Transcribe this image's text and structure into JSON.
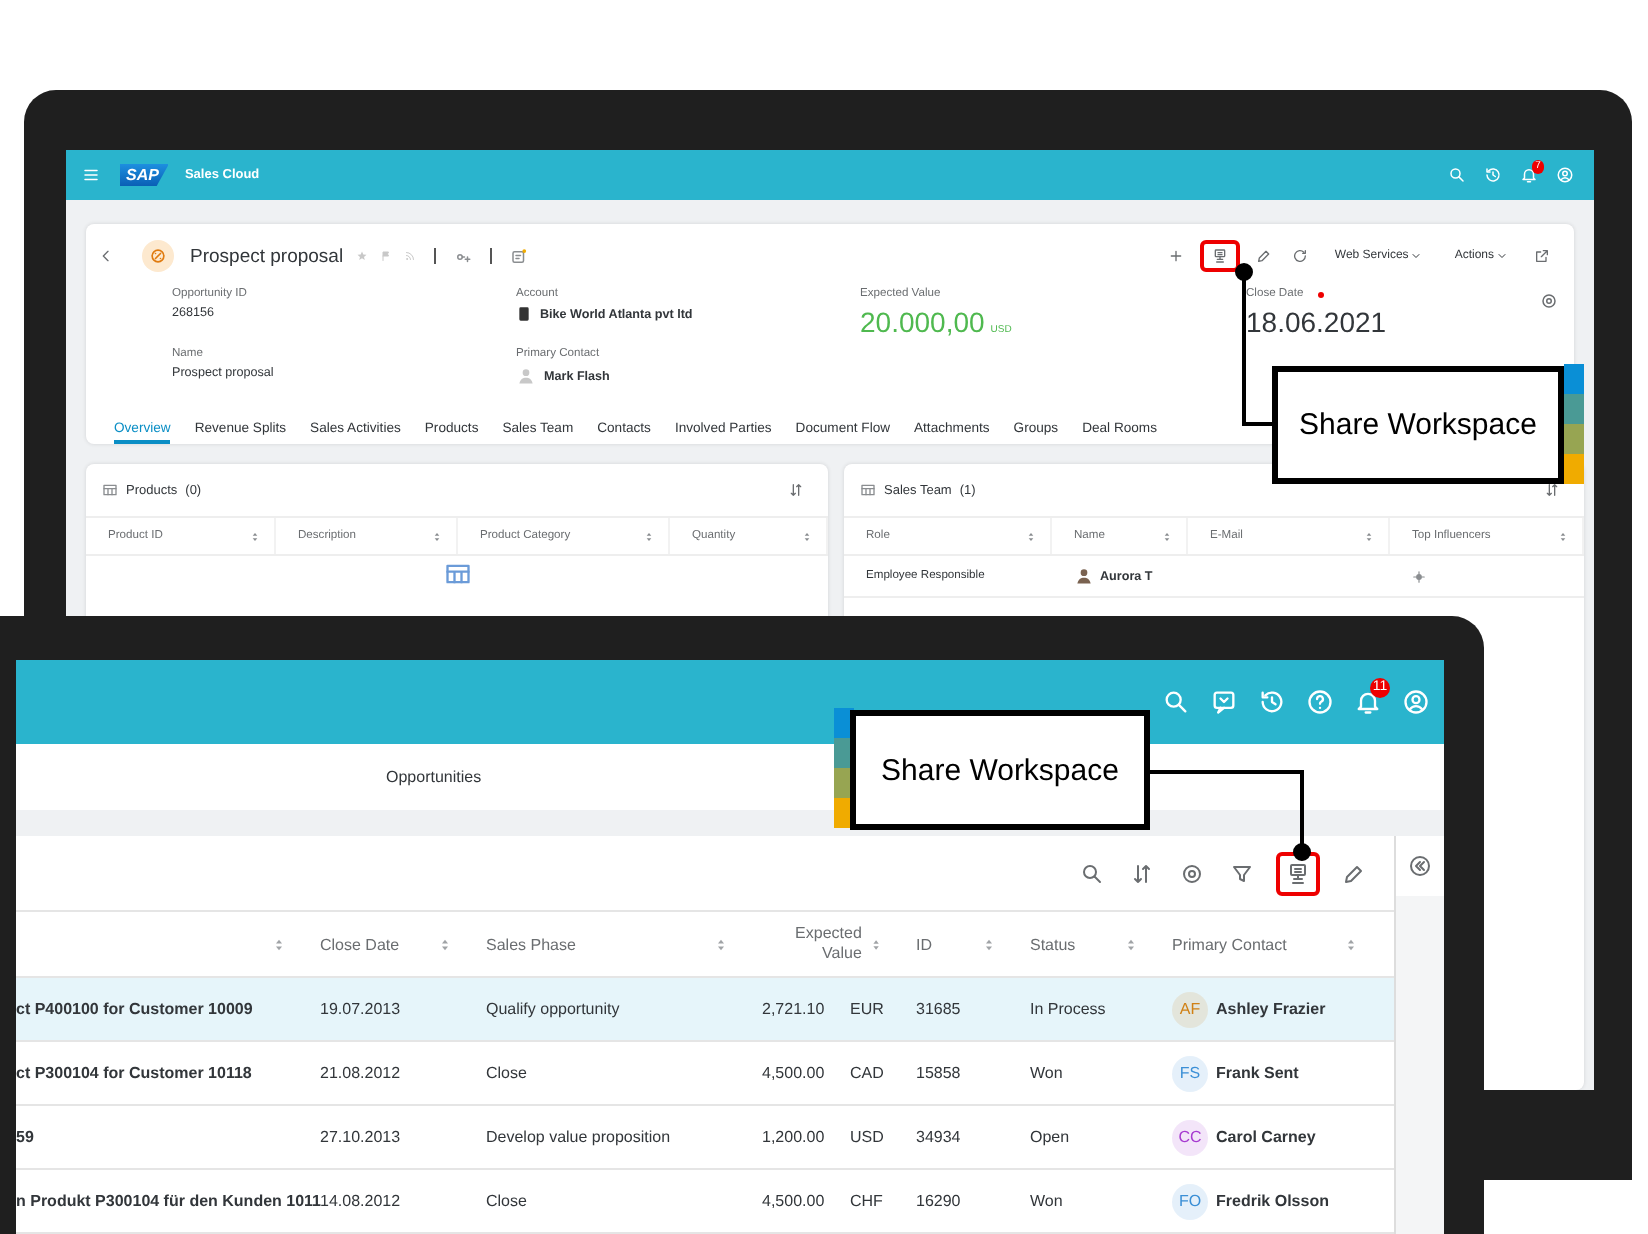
{
  "back_screen": {
    "app_bar": {
      "logo": "SAP",
      "title": "Sales Cloud",
      "notification_count": "7"
    },
    "object_header": {
      "title": "Prospect proposal",
      "menus": [
        "Web Services",
        "Actions"
      ],
      "fields": [
        {
          "kind": "text",
          "label": "Opportunity ID",
          "value": "268156"
        },
        {
          "kind": "account",
          "label": "Account",
          "value": "Bike World Atlanta pvt ltd"
        },
        {
          "kind": "amount",
          "label": "Expected Value",
          "value": "20.000,00",
          "currency": "USD"
        },
        {
          "kind": "date",
          "label": "Close Date",
          "value": "18.06.2021",
          "required": true
        },
        {
          "kind": "text",
          "label": "Name",
          "value": "Prospect proposal"
        },
        {
          "kind": "contact",
          "label": "Primary Contact",
          "value": "Mark Flash"
        }
      ],
      "tabs": [
        {
          "label": "Overview",
          "selected": true
        },
        {
          "label": "Revenue Splits",
          "selected": false
        },
        {
          "label": "Sales Activities",
          "selected": false
        },
        {
          "label": "Products",
          "selected": false
        },
        {
          "label": "Sales Team",
          "selected": false
        },
        {
          "label": "Contacts",
          "selected": false
        },
        {
          "label": "Involved Parties",
          "selected": false
        },
        {
          "label": "Document Flow",
          "selected": false
        },
        {
          "label": "Attachments",
          "selected": false
        },
        {
          "label": "Groups",
          "selected": false
        },
        {
          "label": "Deal Rooms",
          "selected": false
        }
      ]
    },
    "products_card": {
      "title": "Products",
      "count": "(0)",
      "columns": [
        "Product ID",
        "Description",
        "Product Category",
        "Quantity"
      ]
    },
    "sales_team_card": {
      "title": "Sales Team",
      "count": "(1)",
      "columns": [
        "Role",
        "Name",
        "E-Mail",
        "Top Influencers"
      ],
      "rows": [
        {
          "role": "Employee Responsible",
          "name": "Aurora T"
        }
      ]
    },
    "callout": "Share Workspace"
  },
  "front_screen": {
    "app_bar": {
      "notification_count": "11"
    },
    "page_title": "Opportunities",
    "table": {
      "columns": [
        "Close Date",
        "Sales Phase",
        "Expected Value",
        "ID",
        "Status",
        "Primary Contact"
      ],
      "rows": [
        {
          "selected": true,
          "column_1": "ct P400100 for Customer 10009",
          "close_date": "19.07.2013",
          "sales_phase": "Qualify opportunity",
          "expected_value": "2,721.10",
          "currency": "EUR",
          "id": "31685",
          "status": "In Process",
          "contact": {
            "initials": "AF",
            "name": "Ashley Frazier",
            "color": "#d08014"
          }
        },
        {
          "selected": false,
          "column_1": "ct P300104 for Customer 10118",
          "close_date": "21.08.2012",
          "sales_phase": "Close",
          "expected_value": "4,500.00",
          "currency": "CAD",
          "id": "15858",
          "status": "Won",
          "contact": {
            "initials": "FS",
            "name": "Frank Sent",
            "color": "#3b8fd6"
          }
        },
        {
          "selected": false,
          "column_1": "59",
          "close_date": "27.10.2013",
          "sales_phase": "Develop value proposition",
          "expected_value": "1,200.00",
          "currency": "USD",
          "id": "34934",
          "status": "Open",
          "contact": {
            "initials": "CC",
            "name": "Carol Carney",
            "color": "#a63ad0"
          }
        },
        {
          "selected": false,
          "column_1": "n Produkt P300104 für den Kunden 1011",
          "close_date": "14.08.2012",
          "sales_phase": "Close",
          "expected_value": "4,500.00",
          "currency": "CHF",
          "id": "16290",
          "status": "Won",
          "contact": {
            "initials": "FO",
            "name": "Fredrik Olsson",
            "color": "#3b8fd6"
          }
        }
      ]
    },
    "callout": "Share Workspace"
  }
}
